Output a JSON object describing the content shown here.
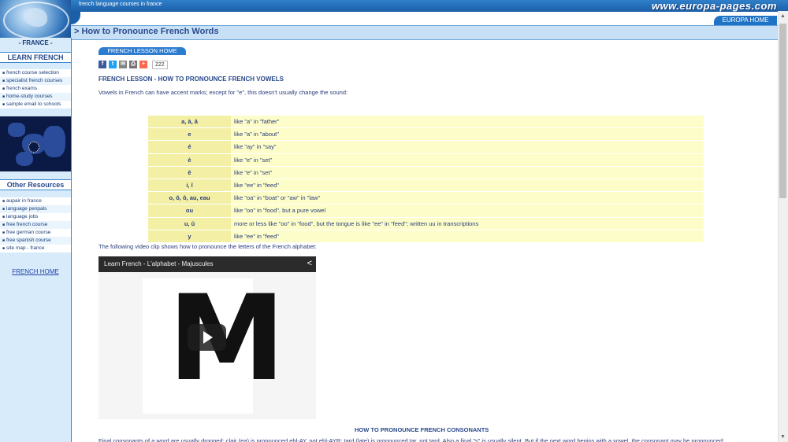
{
  "banner": {
    "tagline": "french language courses in france",
    "brand": "www.europa-pages.com",
    "europa_home": "EUROPA HOME"
  },
  "title": "> How to Pronounce French Words",
  "sidebar": {
    "region": "- FRANCE -",
    "learn_heading": "LEARN FRENCH",
    "learn_items": [
      "french course selection",
      "specialist french courses",
      "french exams",
      "home-study courses",
      "sample email to schools"
    ],
    "resources_heading": "Other Resources",
    "resource_items": [
      "aupair in france",
      "language penpals",
      "language jobs",
      "free french course",
      "free german course",
      "free spanish course",
      "site map - france"
    ],
    "home_link": "FRENCH HOME"
  },
  "content": {
    "lesson_home": "FRENCH LESSON HOME",
    "share_count": "222",
    "lesson_heading": "FRENCH LESSON - HOW TO PRONOUNCE FRENCH VOWELS",
    "intro": "Vowels in French can have accent marks; except for \"e\", this doesn't usually change the sound:",
    "vowels": [
      {
        "vowel": "a, à, â",
        "sound": "like \"a\" in \"father\""
      },
      {
        "vowel": "e",
        "sound": "like \"a\" in \"about\""
      },
      {
        "vowel": "é",
        "sound": "like \"ay\" in \"say\""
      },
      {
        "vowel": "è",
        "sound": "like \"e\" in \"set\""
      },
      {
        "vowel": "ê",
        "sound": "like \"e\" in \"set\""
      },
      {
        "vowel": "i, î",
        "sound": "like \"ee\" in \"feed\""
      },
      {
        "vowel": "o, ô, ô, au, eau",
        "sound": "like \"oa\" in \"boat\" or \"aw\" in \"law\""
      },
      {
        "vowel": "ou",
        "sound": "like \"oo\" in \"food\", but a pure vowel"
      },
      {
        "vowel": "u, û",
        "sound": "more or less like \"oo\" in \"food\", but the tongue is like \"ee\" in \"feed\"; written uu in transcriptions"
      },
      {
        "vowel": "y",
        "sound": "like \"ee\" in \"feed\""
      }
    ],
    "clip_caption": "The following video clip shows how to pronounce the letters of the French alphabet:",
    "video_title": "Learn French - L'alphabet - Majuscules",
    "video_letter": "M",
    "consonants_heading": "HOW TO PRONOUNCE FRENCH CONSONANTS",
    "consonants_text": "Final consonants of a word are usually dropped: clair (ea) is pronounced ebl-AY, not ebl-AYR; tard (late) is pronounced tar, not tard. Also a final \"s\" is usually silent. But if the next word begins with a vowel, the consonant may be pronounced:"
  },
  "icons": {
    "share": [
      "facebook-icon",
      "twitter-icon",
      "email-icon",
      "print-icon",
      "addthis-icon"
    ]
  },
  "colors": {
    "sidebar_bg": "#d7ebfb",
    "accent": "#1f73c6",
    "vowel_cell": "#f3f0a6",
    "desc_cell": "#fdfdc9"
  }
}
